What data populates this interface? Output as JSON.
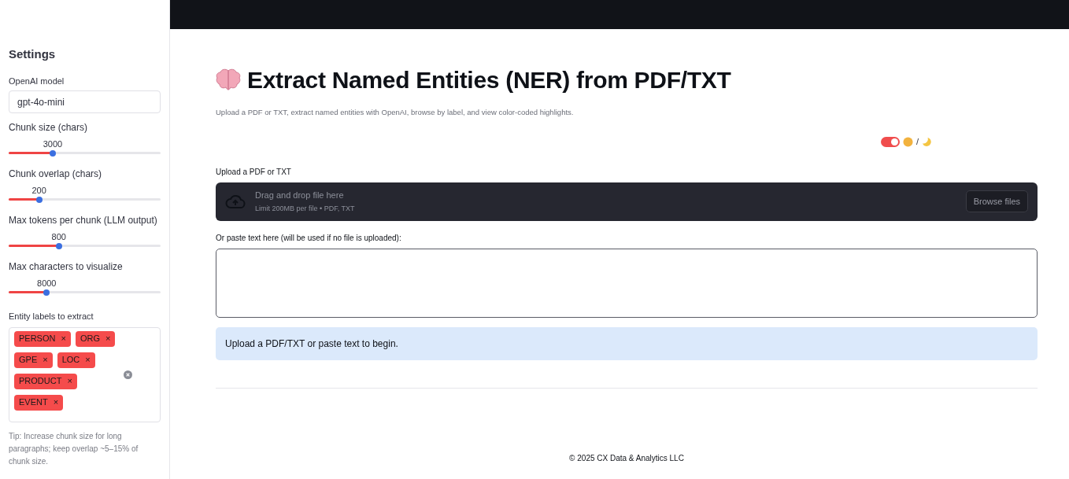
{
  "sidebar": {
    "title": "Settings",
    "model": {
      "label": "OpenAI model",
      "value": "gpt-4o-mini"
    },
    "sliders": [
      {
        "label": "Chunk size (chars)",
        "reading": "3000",
        "level": 0.29
      },
      {
        "label": "Chunk overlap (chars)",
        "reading": "200",
        "level": 0.2
      },
      {
        "label": "Max tokens per chunk (LLM output)",
        "reading": "800",
        "level": 0.33
      },
      {
        "label": "Max characters to visualize",
        "reading": "8000",
        "level": 0.25
      }
    ],
    "labels": {
      "label": "Entity labels to extract",
      "tags": [
        {
          "text": "PERSON",
          "remove": "×"
        },
        {
          "text": "ORG",
          "remove": "×"
        },
        {
          "text": "GPE",
          "remove": "×"
        },
        {
          "text": "LOC",
          "remove": "×"
        },
        {
          "text": "PRODUCT",
          "remove": "×"
        },
        {
          "text": "EVENT",
          "remove": "×"
        }
      ]
    },
    "tip": "Tip: Increase chunk size for long paragraphs; keep overlap ~5–15% of chunk size."
  },
  "main": {
    "title": "Extract Named Entities (NER) from PDF/TXT",
    "subtitle": "Upload a PDF or TXT, extract named entities with OpenAI, browse by label, and view color-coded highlights.",
    "theme_toggle": {
      "on": true,
      "separator": "/"
    },
    "upload": {
      "label": "Upload a PDF or TXT",
      "heading": "Drag and drop file here",
      "limit": "Limit 200MB per file • PDF, TXT",
      "button": "Browse files"
    },
    "paste": {
      "label": "Or paste text here (will be used if no file is uploaded):"
    },
    "info": "Upload a PDF/TXT or paste text to begin.",
    "footer": "© 2025 CX Data & Analytics LLC"
  }
}
